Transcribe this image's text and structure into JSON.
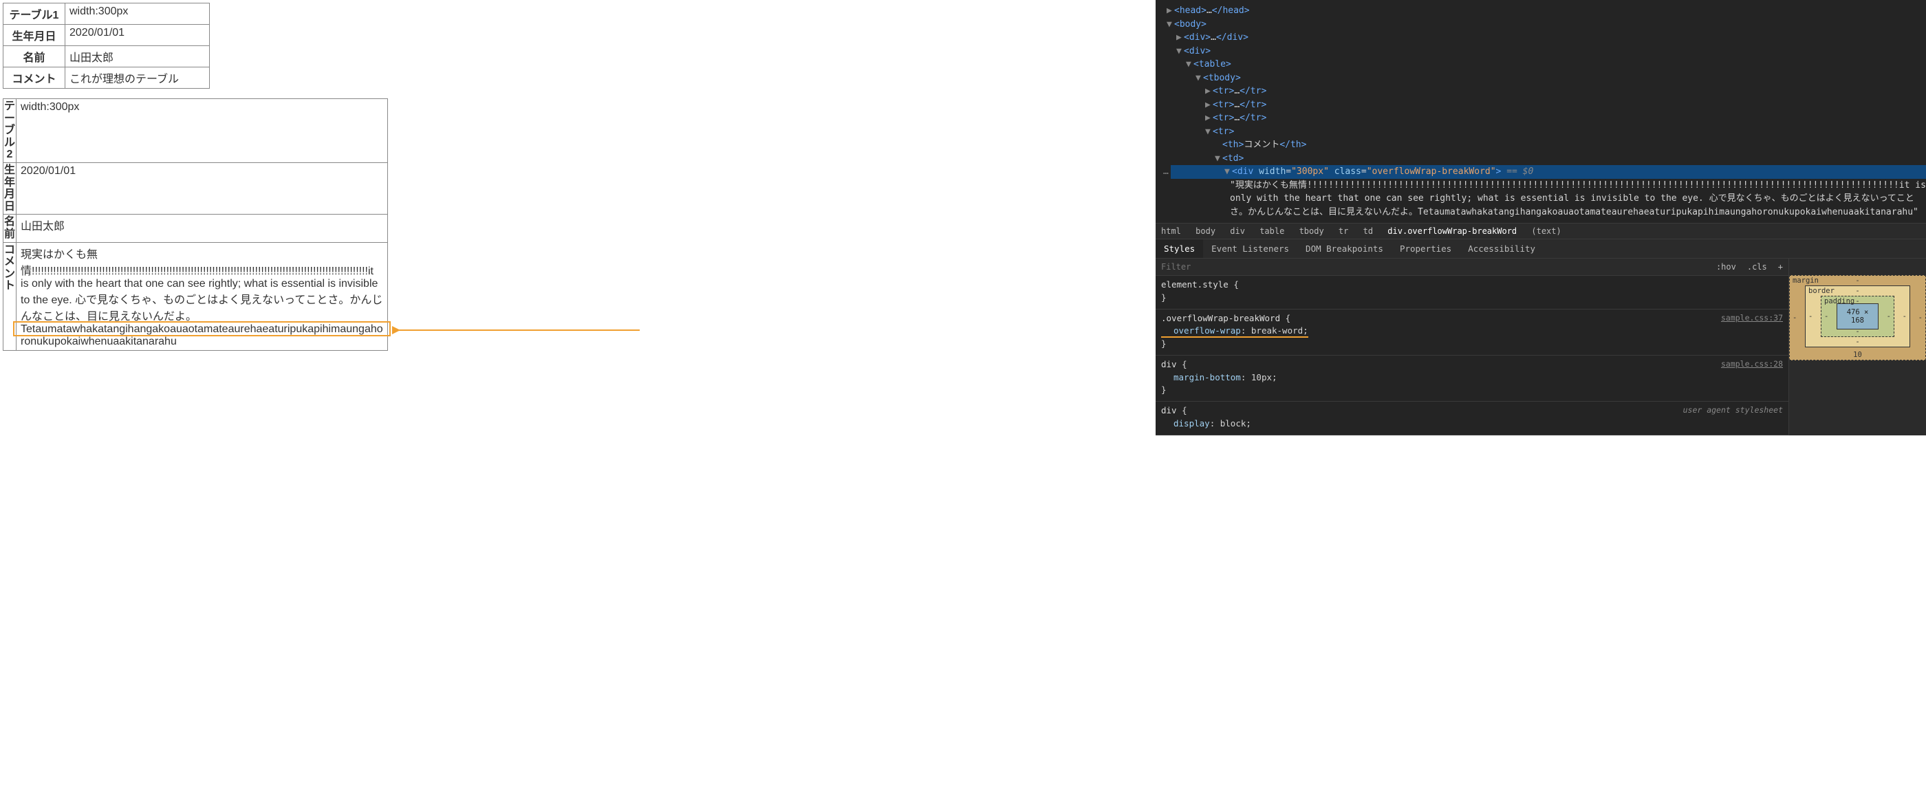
{
  "table1": {
    "rows": [
      {
        "th": "テーブル1",
        "td": "width:300px"
      },
      {
        "th": "生年月日",
        "td": "2020/01/01"
      },
      {
        "th": "名前",
        "td": "山田太郎"
      },
      {
        "th": "コメント",
        "td": "これが理想のテーブル"
      }
    ]
  },
  "table2": {
    "rows": [
      {
        "th": "テーブル2",
        "td": "width:300px"
      },
      {
        "th": "生年月日",
        "td": "2020/01/01"
      },
      {
        "th": "名前",
        "td": "山田太郎"
      },
      {
        "th": "コメント",
        "td": "現実はかくも無情!!!!!!!!!!!!!!!!!!!!!!!!!!!!!!!!!!!!!!!!!!!!!!!!!!!!!!!!!!!!!!!!!!!!!!!!!!!!!!!!!!!!!!!!!!!!!!!!!!!!!!!!!!!!!!it is only with the heart that one can see rightly; what is essential is invisible to the eye. 心で見なくちゃ、ものごとはよく見えないってことさ。かんじんなことは、目に見えないんだよ。Tetaumatawhakatangihangakoauaotamateaurehaeaturipukapihimaungahoronukupokaiwhenuaakitanarahu"
      }
    ]
  },
  "devtools": {
    "elements": {
      "head": {
        "open": "<head>",
        "ell": "…",
        "close": "</head>"
      },
      "body": "<body>",
      "div1": {
        "open": "<div>",
        "ell": "…",
        "close": "</div>"
      },
      "div2": "<div>",
      "table": "<table>",
      "tbody": "<tbody>",
      "tr_ell": {
        "open": "<tr>",
        "ell": "…",
        "close": "</tr>"
      },
      "tr": "<tr>",
      "th": {
        "open": "<th>",
        "text": "コメント",
        "close": "</th>"
      },
      "td": "<td>",
      "selected": {
        "prefix": "<div ",
        "attr1_name": "width",
        "attr1_val": "\"300px\"",
        "attr2_name": "class",
        "attr2_val": "\"overflowWrap-breakWord\"",
        "suffix": ">",
        "eq0": " == $0"
      },
      "text_quote_open": "\"現実はかくも無情!!!!!!!!!!!!!!!!!!!!!!!!!!!!!!!!!!!!!!!!!!!!!!!!!!!!!!!!!!!!!!!!!!!!!!!!!!!!!!!!!!!!!!!!!!!!!!!!!!!!!!!!!!!!!!it is only with the heart that one can see rightly; what is essential is invisible to the eye. 心で見なくちゃ、ものごとはよく見えないってことさ。かんじんなことは、目に見えないんだよ。Tetaumatawhakatangihangakoauaotamateaurehaeaturipukapihimaungahoronukupokaiwhenuaakitanarahu\"",
      "gutter": "…"
    },
    "breadcrumb": [
      "html",
      "body",
      "div",
      "table",
      "tbody",
      "tr",
      "td",
      "div.overflowWrap-breakWord",
      "(text)"
    ],
    "tabs": [
      "Styles",
      "Event Listeners",
      "DOM Breakpoints",
      "Properties",
      "Accessibility"
    ],
    "filter": {
      "placeholder": "Filter",
      "hov": ":hov",
      "cls": ".cls",
      "plus": "+"
    },
    "rules": [
      {
        "selector": "element.style",
        "props": [],
        "src": ""
      },
      {
        "selector": ".overflowWrap-breakWord",
        "props": [
          {
            "name": "overflow-wrap",
            "val": "break-word"
          }
        ],
        "src": "sample.css:37",
        "highlight": true
      },
      {
        "selector": "div",
        "props": [
          {
            "name": "margin-bottom",
            "val": "10px"
          }
        ],
        "src": "sample.css:28"
      },
      {
        "selector": "div",
        "props": [
          {
            "name": "display",
            "val": "block"
          }
        ],
        "ua": "user agent stylesheet"
      }
    ],
    "boxmodel": {
      "margin": {
        "label": "margin",
        "t": "-",
        "r": "-",
        "b": "10",
        "l": "-"
      },
      "border": {
        "label": "border",
        "t": "-",
        "r": "-",
        "b": "-",
        "l": "-"
      },
      "padding": {
        "label": "padding",
        "t": "-",
        "r": "-",
        "b": "-",
        "l": "-"
      },
      "content": "476 × 168"
    }
  }
}
